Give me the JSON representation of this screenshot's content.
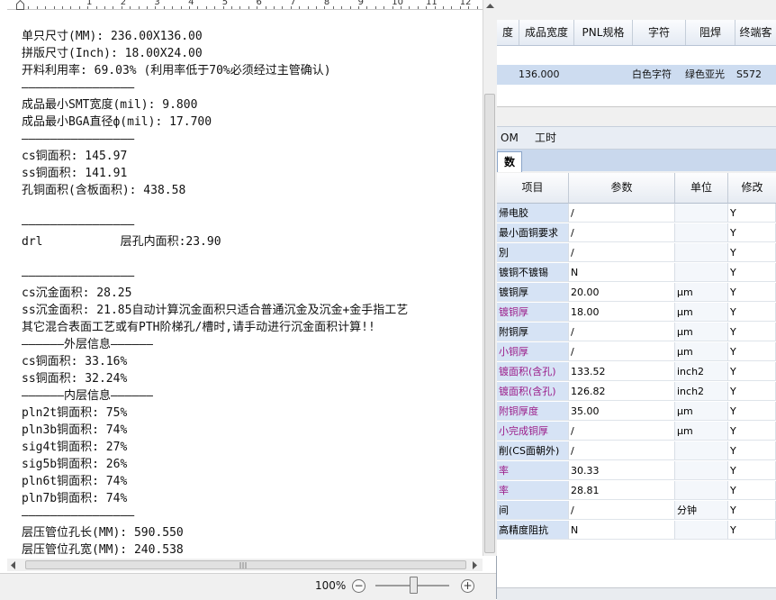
{
  "editor": {
    "ruler_numbers": [
      "1",
      "2",
      "3",
      "4",
      "5",
      "6",
      "7",
      "8",
      "9",
      "10",
      "11",
      "12",
      "13"
    ],
    "lines": [
      "单只尺寸(MM): 236.00X136.00",
      "拼版尺寸(Inch): 18.00X24.00",
      "开料利用率: 69.03% (利用率低于70%必须经过主管确认)",
      "————————————————",
      "成品最小SMT宽度(mil): 9.800",
      "成品最小BGA直径ф(mil): 17.700",
      "————————————————",
      "cs铜面积: 145.97",
      "ss铜面积: 141.91",
      "孔铜面积(含板面积): 438.58",
      "",
      "————————————————",
      "drl           层孔内面积:23.90",
      "",
      "————————————————",
      "cs沉金面积: 28.25",
      "ss沉金面积: 21.85自动计算沉金面积只适合普通沉金及沉金+金手指工艺",
      "其它混合表面工艺或有PTH阶梯孔/槽时,请手动进行沉金面积计算!!",
      "——————外层信息——————",
      "cs铜面积: 33.16%",
      "ss铜面积: 32.24%",
      "——————内层信息——————",
      "pln2t铜面积: 75%",
      "pln3b铜面积: 74%",
      "sig4t铜面积: 27%",
      "sig5b铜面积: 26%",
      "pln6t铜面积: 74%",
      "pln7b铜面积: 74%",
      "————————————————",
      "层压管位孔长(MM): 590.550",
      "层压管位孔宽(MM): 240.538"
    ],
    "zoom": "100%",
    "zoom_minus": "−",
    "zoom_plus": "+"
  },
  "top_grid": {
    "headers": [
      "度",
      "成品宽度",
      "PNL规格",
      "字符",
      "阻焊",
      "终端客"
    ],
    "row": [
      "",
      "136.000",
      "",
      "白色字符",
      "绿色亚光",
      "S572"
    ]
  },
  "tabs": {
    "left": "OM",
    "right": "工时"
  },
  "subtab": "数",
  "param_grid": {
    "headers": [
      "项目",
      "参数",
      "单位",
      "修改"
    ],
    "rows": [
      {
        "item": "帰电胶",
        "param": "/",
        "unit": "",
        "mod": "Y",
        "purple": false
      },
      {
        "item": "最小面铜要求",
        "param": "/",
        "unit": "",
        "mod": "Y",
        "purple": false
      },
      {
        "item": "別",
        "param": "/",
        "unit": "",
        "mod": "Y",
        "purple": false
      },
      {
        "item": "镀铜不镀锡",
        "param": "N",
        "unit": "",
        "mod": "Y",
        "purple": false
      },
      {
        "item": "镀铜厚",
        "param": "20.00",
        "unit": "μm",
        "mod": "Y",
        "purple": false
      },
      {
        "item": "镀铜厚",
        "param": "18.00",
        "unit": "μm",
        "mod": "Y",
        "purple": true
      },
      {
        "item": "附铜厚",
        "param": "/",
        "unit": "μm",
        "mod": "Y",
        "purple": false
      },
      {
        "item": "小铜厚",
        "param": "/",
        "unit": "μm",
        "mod": "Y",
        "purple": true
      },
      {
        "item": "镀面积(含孔)",
        "param": "133.52",
        "unit": "inch2",
        "mod": "Y",
        "purple": true
      },
      {
        "item": "镀面积(含孔)",
        "param": "126.82",
        "unit": "inch2",
        "mod": "Y",
        "purple": true
      },
      {
        "item": "附铜厚度",
        "param": "35.00",
        "unit": "μm",
        "mod": "Y",
        "purple": true
      },
      {
        "item": "小完成铜厚",
        "param": "/",
        "unit": "μm",
        "mod": "Y",
        "purple": true
      },
      {
        "item": "削(CS面朝外)",
        "param": "/",
        "unit": "",
        "mod": "Y",
        "purple": false
      },
      {
        "item": "率",
        "param": "30.33",
        "unit": "",
        "mod": "Y",
        "purple": true
      },
      {
        "item": "率",
        "param": "28.81",
        "unit": "",
        "mod": "Y",
        "purple": true
      },
      {
        "item": "间",
        "param": "/",
        "unit": "分钟",
        "mod": "Y",
        "purple": false
      },
      {
        "item": "高精度阻抗",
        "param": "N",
        "unit": "",
        "mod": "Y",
        "purple": false
      }
    ]
  }
}
